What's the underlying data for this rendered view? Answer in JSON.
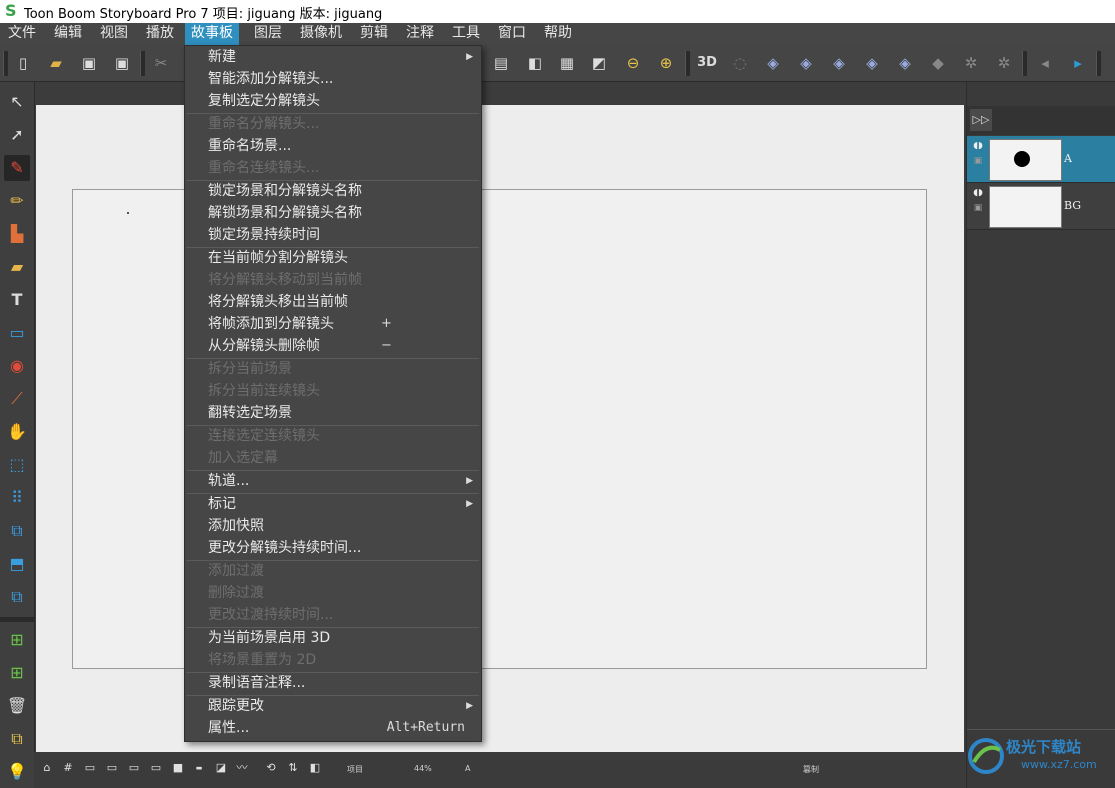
{
  "window": {
    "title": "Toon Boom Storyboard Pro 7 项目: jiguang 版本: jiguang"
  },
  "menubar": [
    {
      "label": "文件"
    },
    {
      "label": "编辑"
    },
    {
      "label": "视图"
    },
    {
      "label": "播放"
    },
    {
      "label": "故事板",
      "active": true
    },
    {
      "label": "图层"
    },
    {
      "label": "摄像机"
    },
    {
      "label": "剪辑"
    },
    {
      "label": "注释"
    },
    {
      "label": "工具"
    },
    {
      "label": "窗口"
    },
    {
      "label": "帮助"
    }
  ],
  "toolbar": {
    "icons": [
      "new-file-icon",
      "open-folder-icon",
      "save-icon",
      "save-as-icon",
      "cut-icon",
      "layout-icon",
      "panel-view-icon",
      "grid-icon",
      "thumbnail-icon",
      "zoom-out-icon",
      "zoom-in-icon",
      "3d-icon",
      "3d-off-icon",
      "add-panel-icon",
      "duplicate-panel-icon",
      "copy-panel-icon",
      "add-scene-icon",
      "scene-properties-icon",
      "camera-icon",
      "camera-off-icon",
      "camera-reset-icon",
      "prev-icon",
      "next-icon"
    ],
    "label_3d": "3D"
  },
  "storyboard_menu": {
    "items": [
      {
        "label": "新建",
        "submenu": true
      },
      {
        "label": "智能添加分解镜头..."
      },
      {
        "label": "复制选定分解镜头"
      },
      {
        "sep": true
      },
      {
        "label": "重命名分解镜头...",
        "disabled": true
      },
      {
        "label": "重命名场景..."
      },
      {
        "label": "重命名连续镜头...",
        "disabled": true
      },
      {
        "sep": true
      },
      {
        "label": "锁定场景和分解镜头名称"
      },
      {
        "label": "解锁场景和分解镜头名称"
      },
      {
        "label": "锁定场景持续时间"
      },
      {
        "sep": true
      },
      {
        "label": "在当前帧分割分解镜头"
      },
      {
        "label": "将分解镜头移动到当前帧",
        "disabled": true
      },
      {
        "label": "将分解镜头移出当前帧"
      },
      {
        "label": "将帧添加到分解镜头",
        "shortcut": "+"
      },
      {
        "label": "从分解镜头删除帧",
        "shortcut": "−"
      },
      {
        "sep": true
      },
      {
        "label": "拆分当前场景",
        "disabled": true
      },
      {
        "label": "拆分当前连续镜头",
        "disabled": true
      },
      {
        "label": "翻转选定场景"
      },
      {
        "sep": true
      },
      {
        "label": "连接选定连续镜头",
        "disabled": true
      },
      {
        "label": "加入选定幕",
        "disabled": true
      },
      {
        "sep": true
      },
      {
        "label": "轨道...",
        "submenu": true
      },
      {
        "sep": true
      },
      {
        "label": "标记",
        "submenu": true
      },
      {
        "label": "添加快照"
      },
      {
        "label": "更改分解镜头持续时间..."
      },
      {
        "sep": true
      },
      {
        "label": "添加过渡",
        "disabled": true
      },
      {
        "label": "删除过渡",
        "disabled": true
      },
      {
        "label": "更改过渡持续时间...",
        "disabled": true
      },
      {
        "sep": true
      },
      {
        "label": "为当前场景启用 3D"
      },
      {
        "label": "将场景重置为 2D",
        "disabled": true
      },
      {
        "sep": true
      },
      {
        "label": "录制语音注释..."
      },
      {
        "sep": true
      },
      {
        "label": "跟踪更改",
        "submenu": true
      },
      {
        "label": "属性...",
        "shortcut_right": "Alt+Return"
      }
    ]
  },
  "layers": [
    {
      "name": "A",
      "selected": true
    },
    {
      "name": "BG",
      "selected": false
    }
  ],
  "statusbar": {
    "project_label": "项目",
    "zoom": "44%",
    "layer_indicator": "A",
    "mode_label": "篡制"
  },
  "watermark": {
    "text": "极光下载站",
    "url": "www.xz7.com"
  }
}
